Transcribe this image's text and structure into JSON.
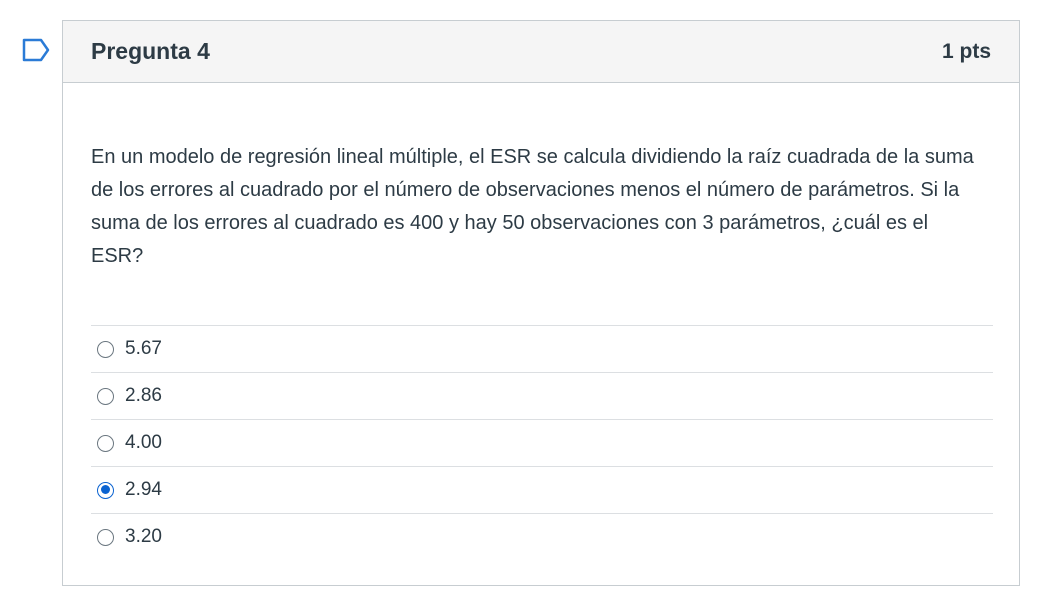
{
  "question": {
    "title": "Pregunta 4",
    "points": "1 pts",
    "text": "En un modelo de regresión lineal múltiple, el ESR se calcula dividiendo la raíz cuadrada de la suma de los errores al cuadrado por el número de observaciones menos el número de parámetros. Si la suma de los errores al cuadrado es 400 y hay 50 observaciones con 3 parámetros, ¿cuál es el ESR?",
    "flag_icon": "flag-icon",
    "answers": [
      {
        "label": "5.67",
        "selected": false
      },
      {
        "label": "2.86",
        "selected": false
      },
      {
        "label": "4.00",
        "selected": false
      },
      {
        "label": "2.94",
        "selected": true
      },
      {
        "label": "3.20",
        "selected": false
      }
    ]
  },
  "colors": {
    "accent": "#0b63d1",
    "header_bg": "#f5f5f5",
    "border": "#c7cdd1",
    "text": "#2d3b45"
  }
}
